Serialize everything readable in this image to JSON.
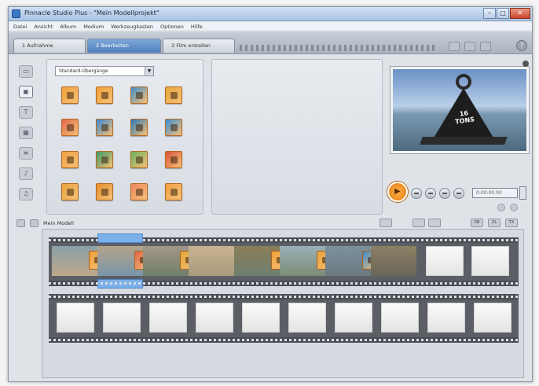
{
  "window": {
    "title": "Pinnacle Studio Plus - \"Mein Modellprojekt\"",
    "controls": {
      "minimize": "–",
      "maximize": "□",
      "close": "✕"
    }
  },
  "menu": [
    "Datei",
    "Ansicht",
    "Album",
    "Medium",
    "Werkzeugkasten",
    "Optionen",
    "Hilfe"
  ],
  "tabs": [
    {
      "label": "1 Aufnahme",
      "active": false
    },
    {
      "label": "2 Bearbeiten",
      "active": true
    },
    {
      "label": "3 Film erstellen",
      "active": false
    }
  ],
  "toolbar_icons": [
    "undo-icon",
    "redo-icon",
    "help-icon"
  ],
  "side_tools": [
    {
      "icon": "video-icon",
      "glyph": "▭"
    },
    {
      "icon": "transition-icon",
      "glyph": "▣"
    },
    {
      "icon": "title-icon",
      "glyph": "T"
    },
    {
      "icon": "photo-icon",
      "glyph": "▦"
    },
    {
      "icon": "menu-icon",
      "glyph": "≡"
    },
    {
      "icon": "sound-icon",
      "glyph": "♪"
    },
    {
      "icon": "music-icon",
      "glyph": "♫"
    }
  ],
  "album": {
    "dropdown_value": "Standard-Übergänge",
    "thumbnails": [
      {
        "color": "#f0a039",
        "icon": "transition-dissolve-icon"
      },
      {
        "color": "#f0a039",
        "icon": "transition-push-icon"
      },
      {
        "color": "#3f8dc9",
        "icon": "transition-slide-icon"
      },
      {
        "color": "#e4a63a",
        "icon": "transition-wipe-icon"
      },
      {
        "color": "#e2694a",
        "icon": "transition-fade-icon"
      },
      {
        "color": "#3a88d2",
        "icon": "transition-split-icon"
      },
      {
        "color": "#2b7ab7",
        "icon": "transition-zoom-icon"
      },
      {
        "color": "#3c8fd6",
        "icon": "transition-bars-icon"
      },
      {
        "color": "#f09e42",
        "icon": "transition-star-icon"
      },
      {
        "color": "#3b9a6a",
        "icon": "transition-iris-icon"
      },
      {
        "color": "#6ab05c",
        "icon": "transition-checker-icon"
      },
      {
        "color": "#d9533c",
        "icon": "transition-heart-icon"
      },
      {
        "color": "#e9a23c",
        "icon": "transition-gradient-icon"
      },
      {
        "color": "#e78e2d",
        "icon": "transition-box-icon"
      },
      {
        "color": "#ee8660",
        "icon": "transition-arrow-icon"
      },
      {
        "color": "#f2a043",
        "icon": "transition-clock-icon"
      }
    ]
  },
  "player": {
    "weight_label_line1": "16",
    "weight_label_line2": "TONS",
    "timecode": "0:00:00.00",
    "play_glyph": "▶"
  },
  "timeline": {
    "project_label": "Mein Modell",
    "view_buttons": [
      "SB",
      "ZL",
      "TX"
    ]
  },
  "storyboard": {
    "row1": [
      {
        "type": "clip",
        "colors": [
          "#8aa0a8",
          "#bfa88a"
        ]
      },
      {
        "type": "transition",
        "color": "#f0a039"
      },
      {
        "type": "clip",
        "colors": [
          "#b2a38a",
          "#7a95a8"
        ]
      },
      {
        "type": "transition",
        "color": "#e2694a"
      },
      {
        "type": "clip",
        "colors": [
          "#a4968a",
          "#6f7f68"
        ]
      },
      {
        "type": "transition",
        "color": "#e4a63a"
      },
      {
        "type": "clip",
        "colors": [
          "#c8b38f",
          "#a89a7e"
        ]
      },
      {
        "type": "clip",
        "colors": [
          "#8a7e58",
          "#6d7f6f"
        ]
      },
      {
        "type": "transition",
        "color": "#f0a039"
      },
      {
        "type": "clip",
        "colors": [
          "#9ab0b8",
          "#7d8d78"
        ]
      },
      {
        "type": "transition",
        "color": "#e9a23c"
      },
      {
        "type": "clip",
        "colors": [
          "#7c909e",
          "#6b7a80"
        ]
      },
      {
        "type": "transition",
        "color": "#3f8dc9"
      },
      {
        "type": "clip",
        "colors": [
          "#8d8064",
          "#6a6658"
        ]
      }
    ],
    "empty_slots_row1": 2,
    "empty_slots_row2": 10
  }
}
